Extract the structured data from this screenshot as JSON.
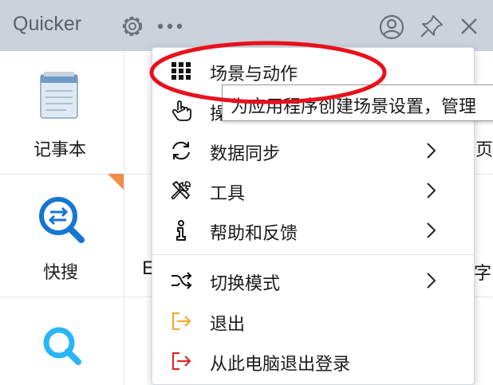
{
  "app": {
    "title": "Quicker"
  },
  "tiles": [
    {
      "label": "记事本"
    },
    {
      "label": "快搜"
    }
  ],
  "partial_labels": {
    "row1_right": "页",
    "row2_mid": "E",
    "row2_right": "字"
  },
  "menu": {
    "items": [
      {
        "label": "场景与动作",
        "icon": "grid-icon"
      },
      {
        "label": "操",
        "icon": "hand-pointer-icon"
      },
      {
        "label": "数据同步",
        "icon": "sync-icon",
        "submenu": true
      },
      {
        "label": "工具",
        "icon": "tools-icon",
        "submenu": true
      },
      {
        "label": "帮助和反馈",
        "icon": "info-icon",
        "submenu": true
      },
      {
        "label": "切换模式",
        "icon": "shuffle-icon",
        "submenu": true
      },
      {
        "label": "退出",
        "icon": "exit-icon",
        "color": "#f5a623"
      },
      {
        "label": "从此电脑退出登录",
        "icon": "logout-icon",
        "color": "#e02020"
      }
    ]
  },
  "tooltip": {
    "text": "为应用程序创建场景设置，管理"
  },
  "colors": {
    "titlebar": "#ccd2db",
    "annotation": "#e8111c",
    "tile_blue": "#1677d2",
    "badge": "#f28c4a"
  }
}
